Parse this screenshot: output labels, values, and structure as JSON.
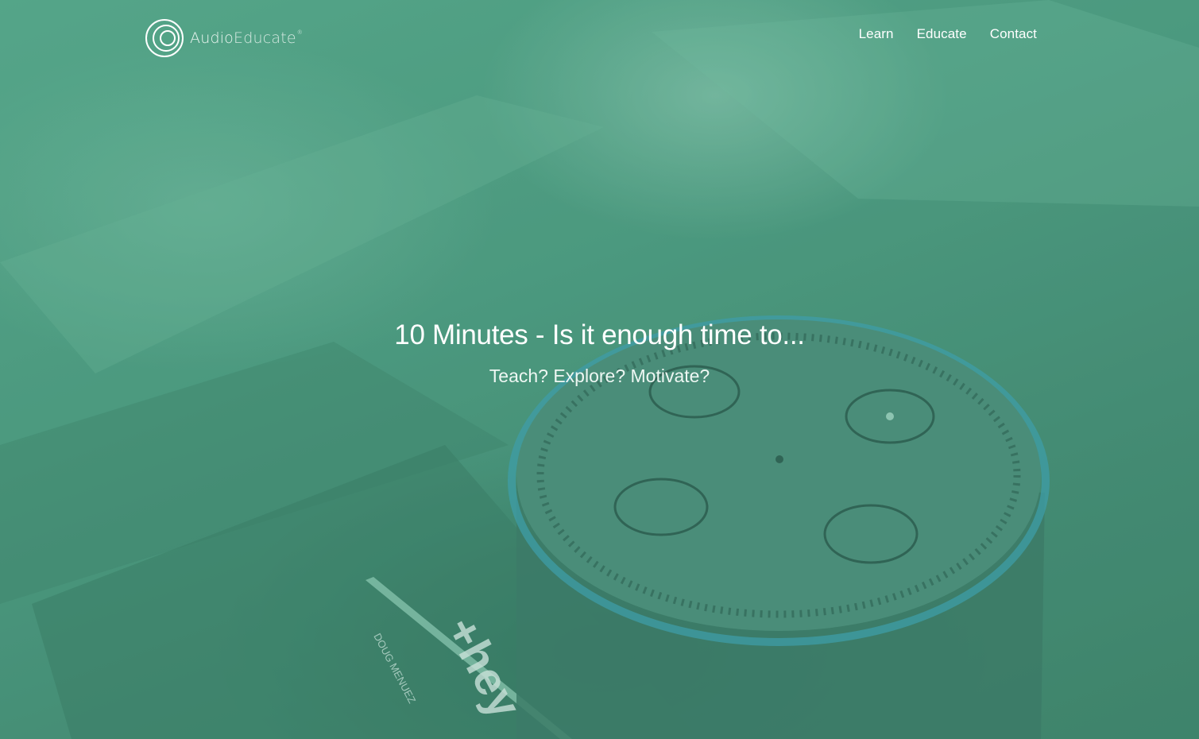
{
  "brand": {
    "name_bold": "Audio",
    "name_light": "Educate",
    "trademark": "®"
  },
  "nav": {
    "items": [
      {
        "label": "Learn"
      },
      {
        "label": "Educate"
      },
      {
        "label": "Contact"
      }
    ]
  },
  "hero": {
    "headline": "10 Minutes - Is it enough time to...",
    "subhead": "Teach? Explore? Motivate?"
  },
  "colors": {
    "overlay": "#4a8f76",
    "text": "#ffffff",
    "ring_accent": "#3f9fb2"
  }
}
